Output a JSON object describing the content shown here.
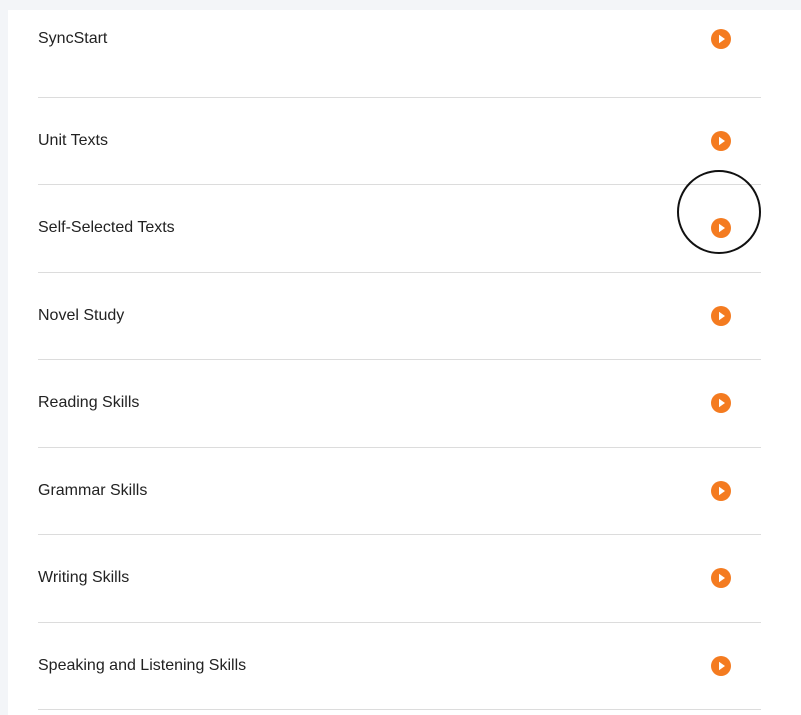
{
  "menu": {
    "items": [
      {
        "label": "SyncStart",
        "icon": "play-circle-icon"
      },
      {
        "label": "Unit Texts",
        "icon": "play-circle-icon"
      },
      {
        "label": "Self-Selected Texts",
        "icon": "play-circle-icon",
        "highlighted": true
      },
      {
        "label": "Novel Study",
        "icon": "play-circle-icon"
      },
      {
        "label": "Reading Skills",
        "icon": "play-circle-icon"
      },
      {
        "label": "Grammar Skills",
        "icon": "play-circle-icon"
      },
      {
        "label": "Writing Skills",
        "icon": "play-circle-icon"
      },
      {
        "label": "Speaking and Listening Skills",
        "icon": "play-circle-icon"
      }
    ]
  },
  "colors": {
    "accent": "#f47b20",
    "text": "#222222",
    "divider": "#dcdcdc",
    "highlight_ring": "#111111"
  }
}
